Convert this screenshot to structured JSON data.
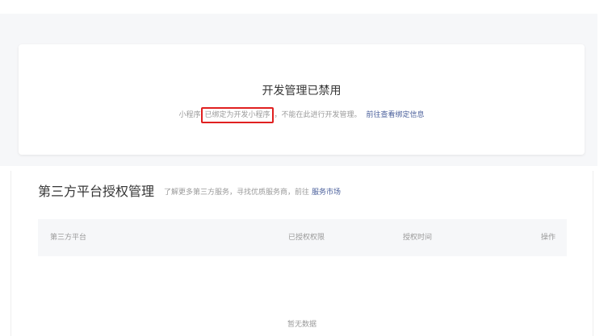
{
  "notice": {
    "title": "开发管理已禁用",
    "desc_prefix": "小程序",
    "desc_highlight": "已绑定为开发小程序",
    "desc_suffix": "，不能在此进行开发管理。",
    "link": "前往查看绑定信息",
    "highlight_color": "#e02020"
  },
  "auth_section": {
    "title": "第三方平台授权管理",
    "desc": "了解更多第三方服务，寻找优质服务商，前往",
    "link": "服务市场",
    "columns": [
      "第三方平台",
      "已授权权限",
      "授权时间",
      "操作"
    ],
    "empty": "暂无数据"
  },
  "colors": {
    "link": "#4a5f9b",
    "muted": "#9a9a9a",
    "header_bg": "#f6f7f9"
  }
}
